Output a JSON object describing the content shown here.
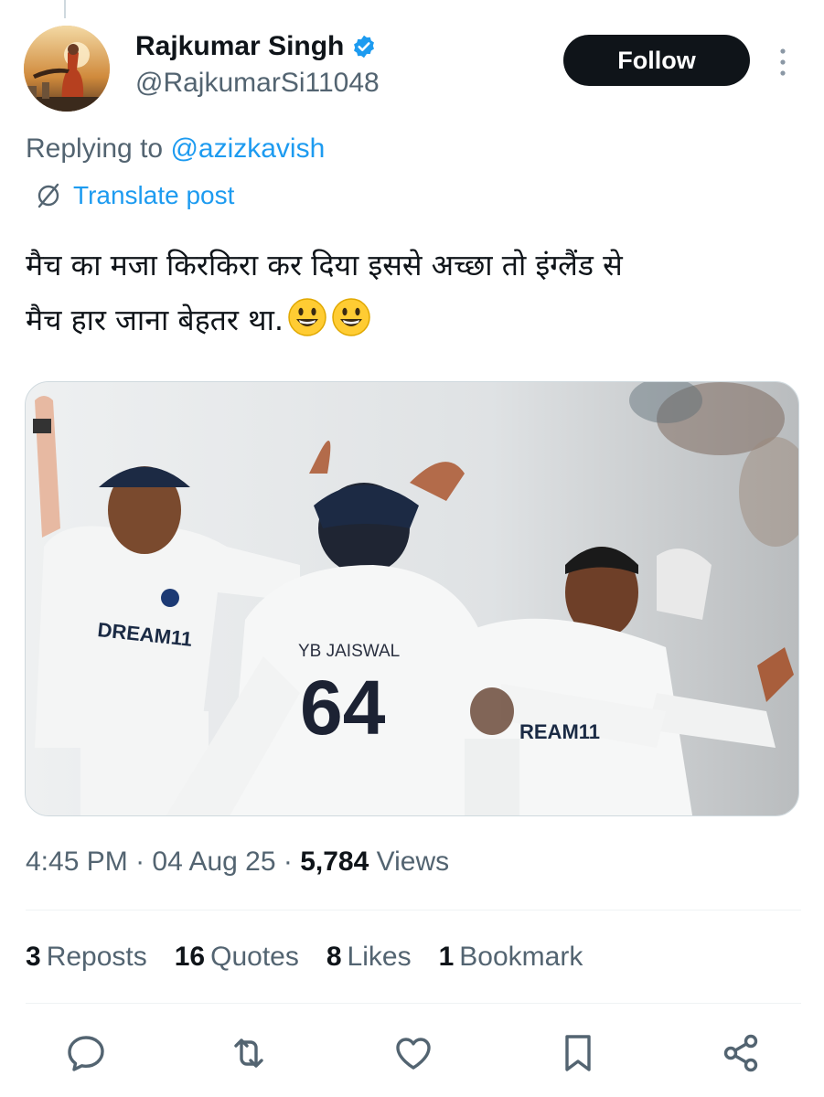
{
  "author": {
    "display_name": "Rajkumar Singh",
    "handle": "@RajkumarSi11048",
    "verified": true,
    "follow_label": "Follow"
  },
  "reply": {
    "prefix": "Replying to ",
    "mention": "@azizkavish"
  },
  "translate_label": "Translate post",
  "post": {
    "line1": "मैच का मजा किरकिरा कर दिया इससे अच्छा तो इंग्लैंड से",
    "line2": "मैच हार जाना बेहतर था."
  },
  "media_text": {
    "jersey_name": "YB JAISWAL",
    "jersey_number": "64",
    "sponsor": "DREAM11"
  },
  "meta": {
    "time": "4:45 PM",
    "sep1": " · ",
    "date": "04 Aug 25",
    "sep2": " · ",
    "views_count": "5,784",
    "views_label": " Views"
  },
  "stats": [
    {
      "num": "3",
      "label": "Reposts"
    },
    {
      "num": "16",
      "label": "Quotes"
    },
    {
      "num": "8",
      "label": "Likes"
    },
    {
      "num": "1",
      "label": "Bookmark"
    }
  ],
  "colors": {
    "accent": "#1d9bf0",
    "text": "#0f1419",
    "muted": "#536471",
    "follow_bg": "#0f1419"
  },
  "icons": [
    "verified-icon",
    "more-icon",
    "translate-icon",
    "reply-icon",
    "repost-icon",
    "like-icon",
    "bookmark-icon",
    "share-icon"
  ]
}
